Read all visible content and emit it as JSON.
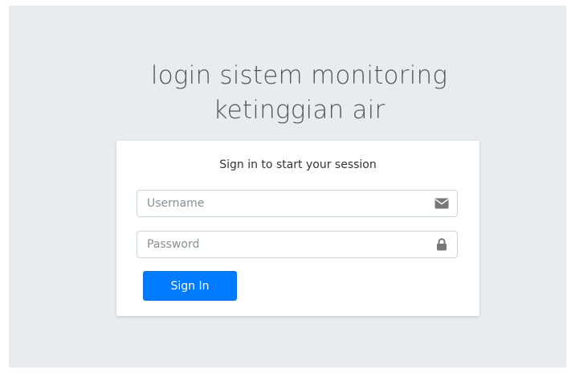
{
  "login": {
    "logo_line1": "login sistem monitoring",
    "logo_line2": "ketinggian air",
    "box_message": "Sign in to start your session",
    "username": {
      "placeholder": "Username",
      "value": "",
      "icon": "envelope-icon"
    },
    "password": {
      "placeholder": "Password",
      "value": "",
      "icon": "lock-icon"
    },
    "submit_label": "Sign In"
  },
  "colors": {
    "page_background": "#e9ecef",
    "card_background": "#ffffff",
    "primary_button": "#007bff",
    "icon": "#777777"
  }
}
